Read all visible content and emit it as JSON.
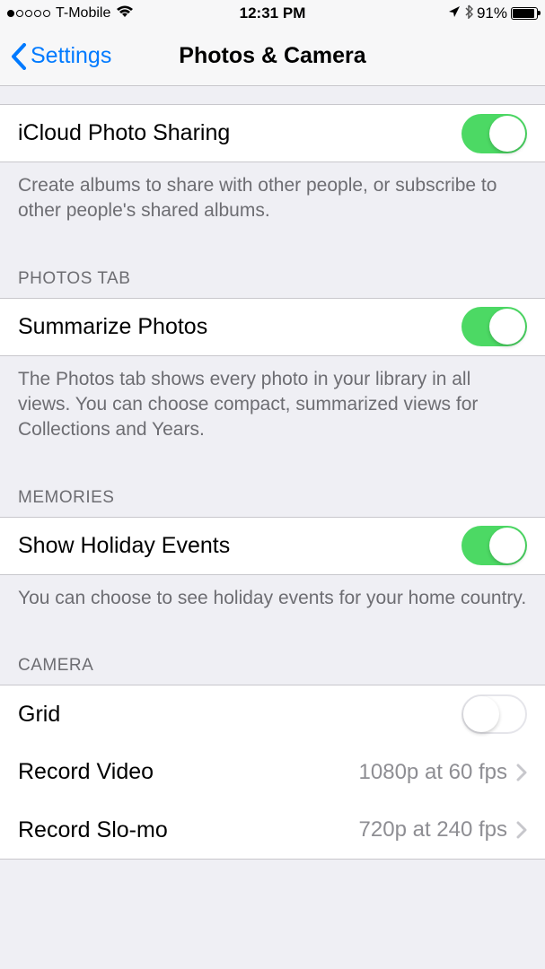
{
  "statusBar": {
    "carrier": "T-Mobile",
    "time": "12:31 PM",
    "batteryPercent": "91%"
  },
  "nav": {
    "back": "Settings",
    "title": "Photos & Camera"
  },
  "rows": {
    "icloudSharing": {
      "label": "iCloud Photo Sharing",
      "footer": "Create albums to share with other people, or subscribe to other people's shared albums."
    },
    "photosTab": {
      "header": "PHOTOS TAB",
      "summarize": {
        "label": "Summarize Photos",
        "footer": "The Photos tab shows every photo in your library in all views. You can choose compact, summarized views for Collections and Years."
      }
    },
    "memories": {
      "header": "MEMORIES",
      "holiday": {
        "label": "Show Holiday Events",
        "footer": "You can choose to see holiday events for your home country."
      }
    },
    "camera": {
      "header": "CAMERA",
      "grid": {
        "label": "Grid"
      },
      "recordVideo": {
        "label": "Record Video",
        "value": "1080p at 60 fps"
      },
      "recordSlomo": {
        "label": "Record Slo-mo",
        "value": "720p at 240 fps"
      }
    }
  }
}
